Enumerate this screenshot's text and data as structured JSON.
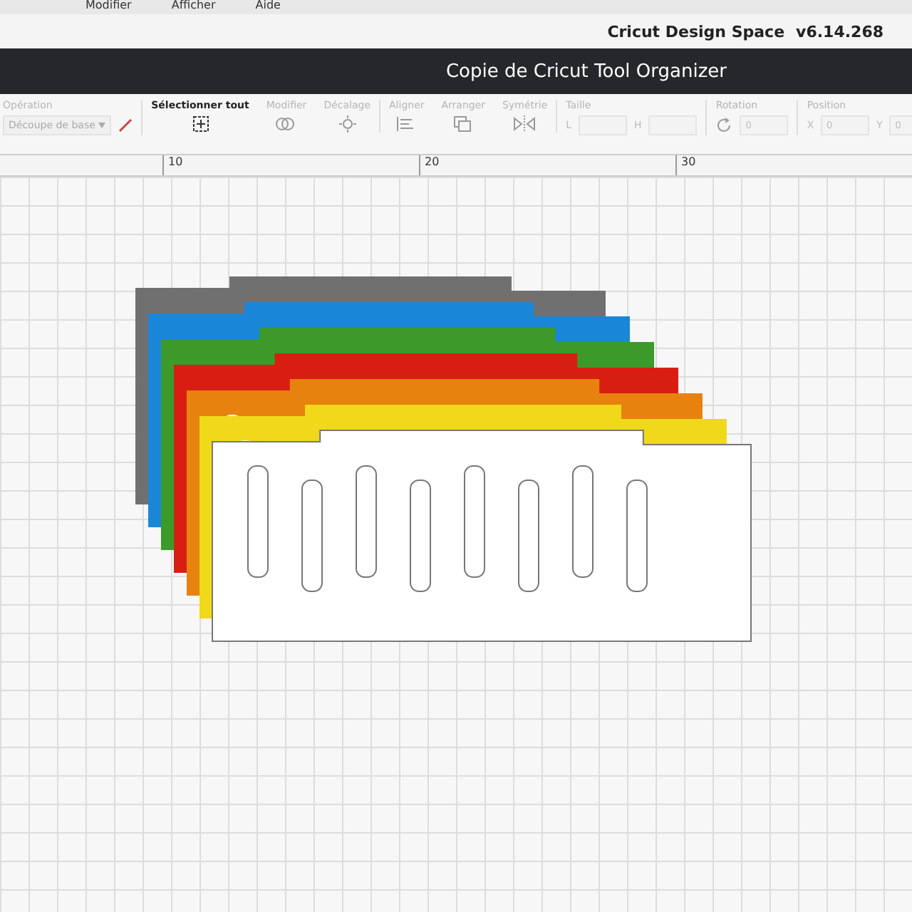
{
  "menu_bar": {
    "items": [
      "Modifier",
      "Afficher",
      "Aide"
    ]
  },
  "app_header": {
    "title": "Cricut Design Space",
    "version": "v6.14.268"
  },
  "project_bar": {
    "title": "Copie de Cricut Tool Organizer"
  },
  "toolbar": {
    "groups": [
      {
        "kind": "select",
        "label": "Opération",
        "value": "Découpe de base",
        "disabled": true
      },
      {
        "kind": "tool",
        "label": "Sélectionner tout",
        "disabled": false
      },
      {
        "kind": "tool",
        "label": "Modifier",
        "disabled": true
      },
      {
        "kind": "tool",
        "label": "Décalage",
        "disabled": true
      },
      {
        "kind": "tool",
        "label": "Aligner",
        "disabled": true
      },
      {
        "kind": "tool",
        "label": "Arranger",
        "disabled": true
      },
      {
        "kind": "tool",
        "label": "Symétrie",
        "disabled": true
      },
      {
        "kind": "size",
        "label": "Taille",
        "fields": [
          {
            "label": "L"
          },
          {
            "label": "H"
          }
        ],
        "disabled": true
      },
      {
        "kind": "rotation",
        "label": "Rotation",
        "fields": [
          {
            "value": "0"
          }
        ],
        "disabled": true
      },
      {
        "kind": "position",
        "label": "Position",
        "fields": [
          {
            "label": "X",
            "value": "0"
          },
          {
            "label": "Y",
            "value": "0"
          }
        ],
        "disabled": true
      }
    ]
  },
  "ruler": {
    "marks": [
      "10",
      "20",
      "30"
    ]
  }
}
